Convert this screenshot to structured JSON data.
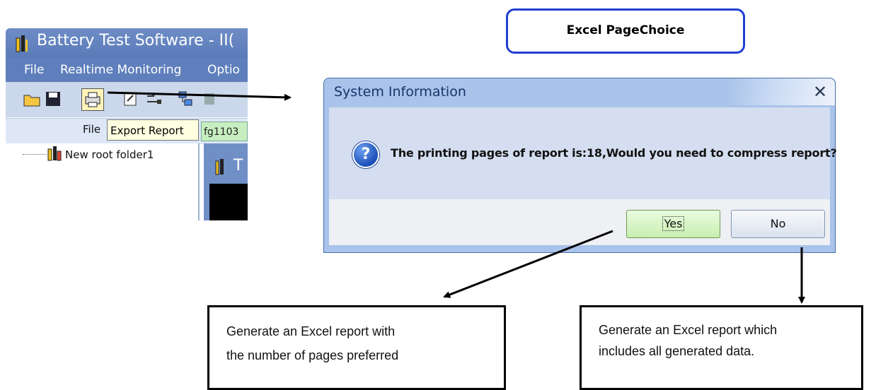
{
  "app_window": {
    "title": "Battery Test Software - II(",
    "menu": [
      "File",
      "Realtime Monitoring",
      "Optio"
    ],
    "toolbar_tabs": {
      "file_label": "File",
      "tooltip": "Export Report",
      "file_field": "fg1103"
    },
    "tree": {
      "root_label": "New root folder1"
    },
    "inner_window_title": "T"
  },
  "annotation_title": "Excel PageChoice",
  "dialog": {
    "title": "System Information",
    "message": "The printing pages of report is:18,Would you need to compress report?",
    "yes_label": "Yes",
    "no_label": "No",
    "close_glyph": "✕"
  },
  "callouts": {
    "yes": [
      "Generate an Excel report with",
      "the number of pages preferred"
    ],
    "no": [
      "Generate an Excel report which",
      "includes all generated data."
    ]
  },
  "colors": {
    "dialog_frame": "#a9c3ea",
    "title_box_border": "#1f3fd0",
    "yes_button": "#c8eeb0",
    "app_titlebar": "#5a7ab8"
  }
}
